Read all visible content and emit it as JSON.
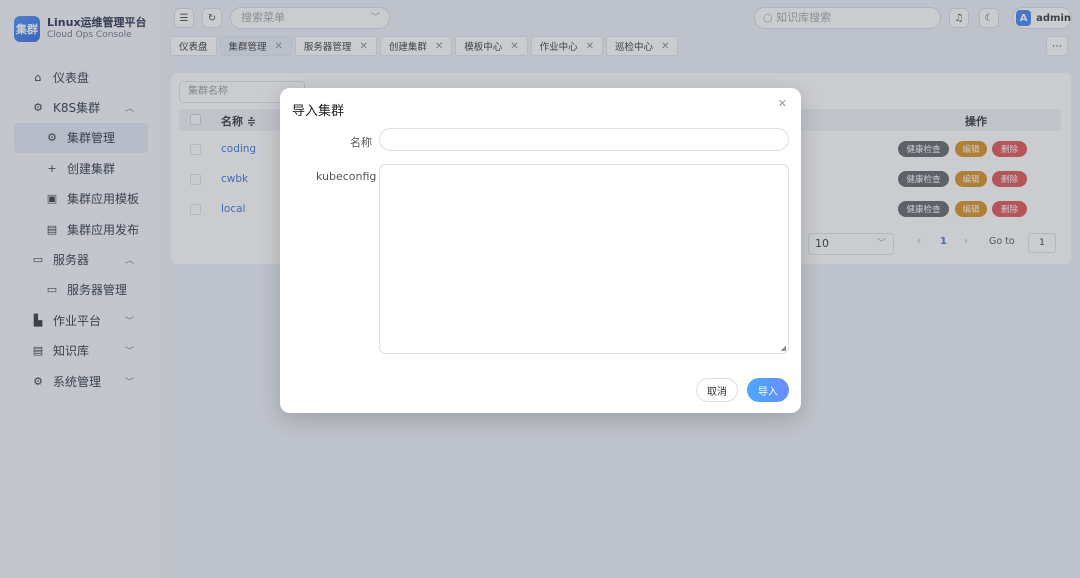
{
  "brand": {
    "logo_text": "集群",
    "title": "Linux运维管理平台",
    "subtitle": "Cloud Ops Console"
  },
  "sidebar": {
    "items": [
      {
        "label": "仪表盘",
        "icon": "home-icon"
      },
      {
        "label": "K8S集群",
        "icon": "gear-icon",
        "arrow": "^"
      },
      {
        "label": "集群管理",
        "icon": "settings-icon"
      },
      {
        "label": "创建集群",
        "icon": "plus-icon"
      },
      {
        "label": "集群应用模板",
        "icon": "save-icon"
      },
      {
        "label": "集群应用发布",
        "icon": "document-icon"
      },
      {
        "label": "服务器",
        "icon": "monitor-icon",
        "arrow": "^"
      },
      {
        "label": "服务器管理",
        "icon": "monitor-icon"
      },
      {
        "label": "作业平台",
        "icon": "task-icon",
        "arrow": "v"
      },
      {
        "label": "知识库",
        "icon": "book-icon",
        "arrow": "v"
      },
      {
        "label": "系统管理",
        "icon": "gear-icon",
        "arrow": "v"
      }
    ]
  },
  "topbar": {
    "menu_search_placeholder": "搜索菜单",
    "kb_search_placeholder": "知识库搜索",
    "user_initial": "A",
    "user_name": "admin"
  },
  "tabs": [
    {
      "label": "仪表盘",
      "closable": false
    },
    {
      "label": "集群管理",
      "closable": true
    },
    {
      "label": "服务器管理",
      "closable": true
    },
    {
      "label": "创建集群",
      "closable": true
    },
    {
      "label": "模板中心",
      "closable": true
    },
    {
      "label": "作业中心",
      "closable": true
    },
    {
      "label": "巡检中心",
      "closable": true
    }
  ],
  "table": {
    "filter_placeholder": "集群名称",
    "col_name": "名称 ≑",
    "col_ops": "操作",
    "rows": [
      {
        "name": "coding"
      },
      {
        "name": "cwbk"
      },
      {
        "name": "local"
      }
    ],
    "btn_health": "健康检查",
    "btn_edit": "编辑",
    "btn_delete": "删除"
  },
  "pagination": {
    "page_size": "10",
    "current_page": "1",
    "goto_label": "Go to",
    "goto_value": "1"
  },
  "dialog": {
    "title": "导入集群",
    "label_name": "名称",
    "label_kubeconfig": "kubeconfig",
    "btn_cancel": "取消",
    "btn_import": "导入"
  }
}
